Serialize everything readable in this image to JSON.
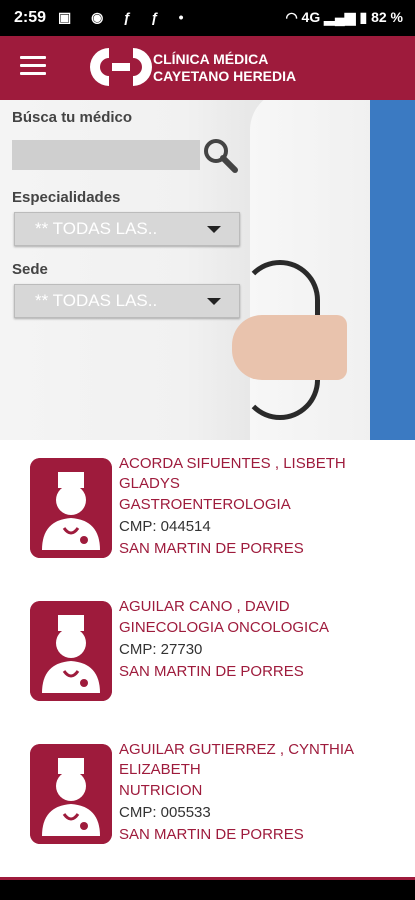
{
  "status_bar": {
    "time": "2:59",
    "battery": "82 %",
    "network": "4G"
  },
  "app": {
    "brand_line1": "CLÍNICA MÉDICA",
    "brand_line2": "CAYETANO HEREDIA"
  },
  "filters": {
    "search_label": "Búsca tu médico",
    "search_value": "",
    "specialty_label": "Especialidades",
    "specialty_value": "** TODAS LAS..",
    "site_label": "Sede",
    "site_value": "** TODAS LAS.."
  },
  "doctors": [
    {
      "name": "ACORDA SIFUENTES , LISBETH GLADYS",
      "specialty": "GASTROENTEROLOGIA",
      "cmp": "CMP: 044514",
      "site": "SAN MARTIN DE PORRES"
    },
    {
      "name": "AGUILAR CANO , DAVID",
      "specialty": "GINECOLOGIA ONCOLOGICA",
      "cmp": "CMP: 27730",
      "site": "SAN MARTIN DE PORRES"
    },
    {
      "name": "AGUILAR GUTIERREZ , CYNTHIA ELIZABETH",
      "specialty": "NUTRICION",
      "cmp": "CMP: 005533",
      "site": "SAN MARTIN DE PORRES"
    }
  ],
  "colors": {
    "brand": "#9e1b3c"
  }
}
